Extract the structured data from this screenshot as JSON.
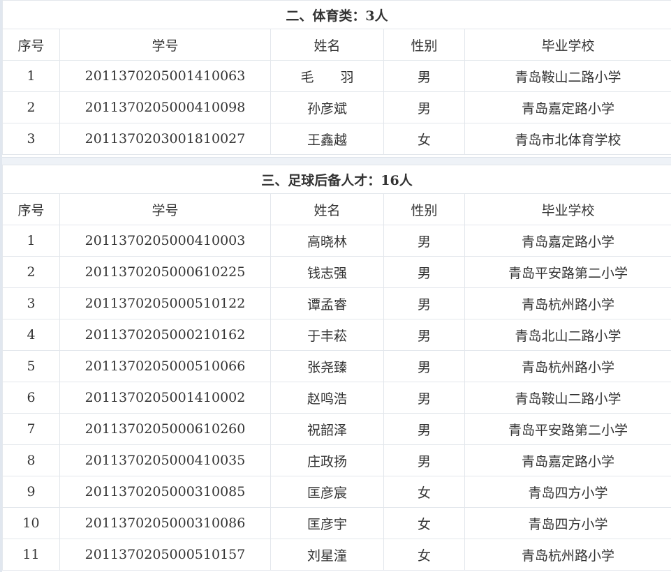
{
  "section2": {
    "title": "二、体育类：3人",
    "headers": [
      "序号",
      "学号",
      "姓名",
      "性别",
      "毕业学校"
    ],
    "rows": [
      [
        "1",
        "2011370205001410063",
        "毛　　羽",
        "男",
        "青岛鞍山二路小学"
      ],
      [
        "2",
        "2011370205000410098",
        "孙彦斌",
        "男",
        "青岛嘉定路小学"
      ],
      [
        "3",
        "2011370203001810027",
        "王鑫越",
        "女",
        "青岛市北体育学校"
      ]
    ]
  },
  "section3": {
    "title": "三、足球后备人才：16人",
    "headers": [
      "序号",
      "学号",
      "姓名",
      "性别",
      "毕业学校"
    ],
    "rows": [
      [
        "1",
        "2011370205000410003",
        "高晓林",
        "男",
        "青岛嘉定路小学"
      ],
      [
        "2",
        "2011370205000610225",
        "钱志强",
        "男",
        "青岛平安路第二小学"
      ],
      [
        "3",
        "2011370205000510122",
        "谭孟睿",
        "男",
        "青岛杭州路小学"
      ],
      [
        "4",
        "2011370205000210162",
        "于丰菘",
        "男",
        "青岛北山二路小学"
      ],
      [
        "5",
        "2011370205000510066",
        "张尧臻",
        "男",
        "青岛杭州路小学"
      ],
      [
        "6",
        "2011370205001410002",
        "赵鸣浩",
        "男",
        "青岛鞍山二路小学"
      ],
      [
        "7",
        "2011370205000610260",
        "祝韶泽",
        "男",
        "青岛平安路第二小学"
      ],
      [
        "8",
        "2011370205000410035",
        "庄政扬",
        "男",
        "青岛嘉定路小学"
      ],
      [
        "9",
        "2011370205000310085",
        "匡彦宸",
        "女",
        "青岛四方小学"
      ],
      [
        "10",
        "2011370205000310086",
        "匡彦宇",
        "女",
        "青岛四方小学"
      ],
      [
        "11",
        "2011370205000510157",
        "刘星潼",
        "女",
        "青岛杭州路小学"
      ]
    ]
  }
}
